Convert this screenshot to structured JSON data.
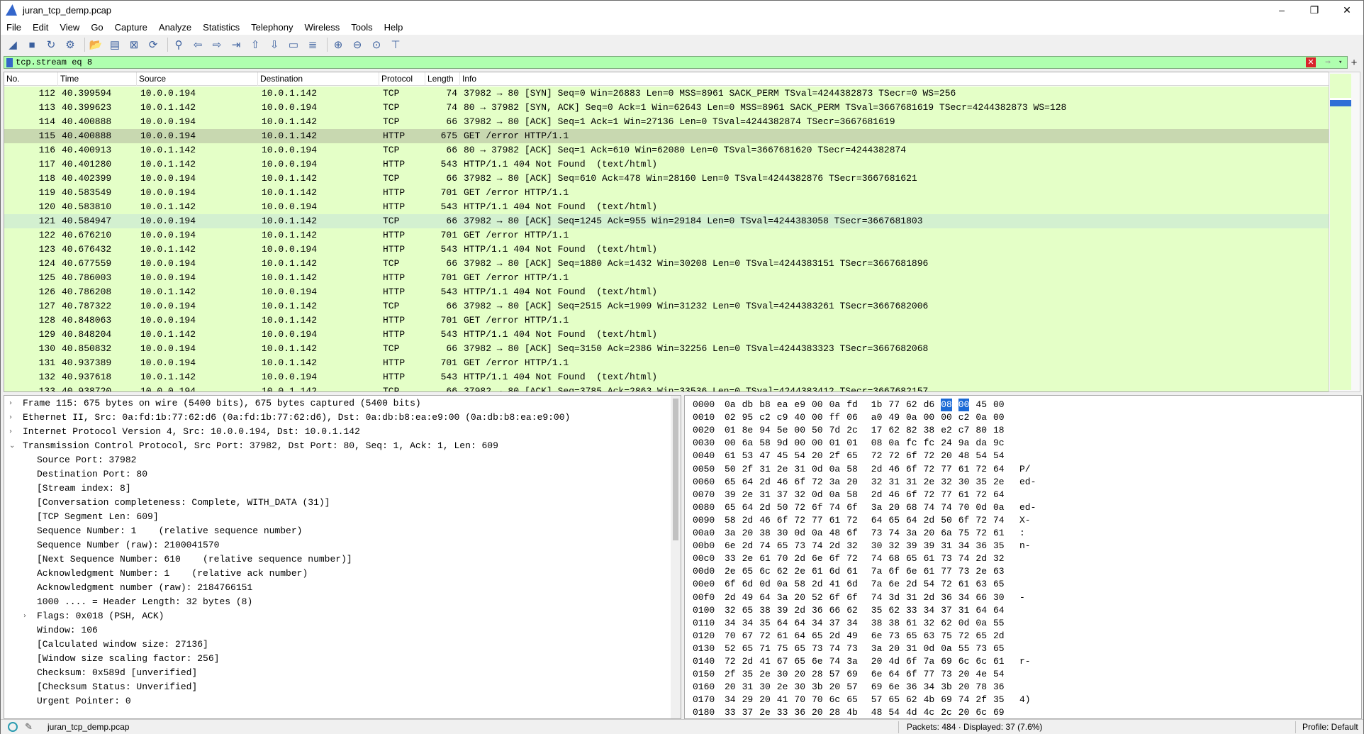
{
  "window": {
    "title": "juran_tcp_demp.pcap",
    "min": "–",
    "max": "❐",
    "close": "✕"
  },
  "menu": [
    "File",
    "Edit",
    "View",
    "Go",
    "Capture",
    "Analyze",
    "Statistics",
    "Telephony",
    "Wireless",
    "Tools",
    "Help"
  ],
  "toolbar_icons": [
    "shark-fin-start-icon",
    "stop-icon",
    "restart-icon",
    "options-icon",
    "open-icon",
    "file-icon",
    "close-file-icon",
    "reload-icon",
    "find-icon",
    "back-icon",
    "forward-icon",
    "goto-icon",
    "first-icon",
    "last-icon",
    "autoscroll-icon",
    "colorize-icon",
    "zoom-in-icon",
    "zoom-out-icon",
    "zoom-normal-icon",
    "resize-columns-icon"
  ],
  "filter": {
    "value": "tcp.stream eq 8",
    "clear": "✕",
    "apply": "⇒",
    "dropdown": "▾",
    "add": "+"
  },
  "packet_list": {
    "columns": [
      "No.",
      "Time",
      "Source",
      "Destination",
      "Protocol",
      "Length",
      "Info"
    ],
    "rows": [
      {
        "no": "112",
        "time": "40.399594",
        "src": "10.0.0.194",
        "dst": "10.0.1.142",
        "proto": "TCP",
        "len": "74",
        "info": "37982 → 80 [SYN] Seq=0 Win=26883 Len=0 MSS=8961 SACK_PERM TSval=4244382873 TSecr=0 WS=256"
      },
      {
        "no": "113",
        "time": "40.399623",
        "src": "10.0.1.142",
        "dst": "10.0.0.194",
        "proto": "TCP",
        "len": "74",
        "info": "80 → 37982 [SYN, ACK] Seq=0 Ack=1 Win=62643 Len=0 MSS=8961 SACK_PERM TSval=3667681619 TSecr=4244382873 WS=128"
      },
      {
        "no": "114",
        "time": "40.400888",
        "src": "10.0.0.194",
        "dst": "10.0.1.142",
        "proto": "TCP",
        "len": "66",
        "info": "37982 → 80 [ACK] Seq=1 Ack=1 Win=27136 Len=0 TSval=4244382874 TSecr=3667681619"
      },
      {
        "no": "115",
        "time": "40.400888",
        "src": "10.0.0.194",
        "dst": "10.0.1.142",
        "proto": "HTTP",
        "len": "675",
        "info": "GET /error HTTP/1.1"
      },
      {
        "no": "116",
        "time": "40.400913",
        "src": "10.0.1.142",
        "dst": "10.0.0.194",
        "proto": "TCP",
        "len": "66",
        "info": "80 → 37982 [ACK] Seq=1 Ack=610 Win=62080 Len=0 TSval=3667681620 TSecr=4244382874"
      },
      {
        "no": "117",
        "time": "40.401280",
        "src": "10.0.1.142",
        "dst": "10.0.0.194",
        "proto": "HTTP",
        "len": "543",
        "info": "HTTP/1.1 404 Not Found  (text/html)"
      },
      {
        "no": "118",
        "time": "40.402399",
        "src": "10.0.0.194",
        "dst": "10.0.1.142",
        "proto": "TCP",
        "len": "66",
        "info": "37982 → 80 [ACK] Seq=610 Ack=478 Win=28160 Len=0 TSval=4244382876 TSecr=3667681621"
      },
      {
        "no": "119",
        "time": "40.583549",
        "src": "10.0.0.194",
        "dst": "10.0.1.142",
        "proto": "HTTP",
        "len": "701",
        "info": "GET /error HTTP/1.1"
      },
      {
        "no": "120",
        "time": "40.583810",
        "src": "10.0.1.142",
        "dst": "10.0.0.194",
        "proto": "HTTP",
        "len": "543",
        "info": "HTTP/1.1 404 Not Found  (text/html)"
      },
      {
        "no": "121",
        "time": "40.584947",
        "src": "10.0.0.194",
        "dst": "10.0.1.142",
        "proto": "TCP",
        "len": "66",
        "info": "37982 → 80 [ACK] Seq=1245 Ack=955 Win=29184 Len=0 TSval=4244383058 TSecr=3667681803"
      },
      {
        "no": "122",
        "time": "40.676210",
        "src": "10.0.0.194",
        "dst": "10.0.1.142",
        "proto": "HTTP",
        "len": "701",
        "info": "GET /error HTTP/1.1"
      },
      {
        "no": "123",
        "time": "40.676432",
        "src": "10.0.1.142",
        "dst": "10.0.0.194",
        "proto": "HTTP",
        "len": "543",
        "info": "HTTP/1.1 404 Not Found  (text/html)"
      },
      {
        "no": "124",
        "time": "40.677559",
        "src": "10.0.0.194",
        "dst": "10.0.1.142",
        "proto": "TCP",
        "len": "66",
        "info": "37982 → 80 [ACK] Seq=1880 Ack=1432 Win=30208 Len=0 TSval=4244383151 TSecr=3667681896"
      },
      {
        "no": "125",
        "time": "40.786003",
        "src": "10.0.0.194",
        "dst": "10.0.1.142",
        "proto": "HTTP",
        "len": "701",
        "info": "GET /error HTTP/1.1"
      },
      {
        "no": "126",
        "time": "40.786208",
        "src": "10.0.1.142",
        "dst": "10.0.0.194",
        "proto": "HTTP",
        "len": "543",
        "info": "HTTP/1.1 404 Not Found  (text/html)"
      },
      {
        "no": "127",
        "time": "40.787322",
        "src": "10.0.0.194",
        "dst": "10.0.1.142",
        "proto": "TCP",
        "len": "66",
        "info": "37982 → 80 [ACK] Seq=2515 Ack=1909 Win=31232 Len=0 TSval=4244383261 TSecr=3667682006"
      },
      {
        "no": "128",
        "time": "40.848063",
        "src": "10.0.0.194",
        "dst": "10.0.1.142",
        "proto": "HTTP",
        "len": "701",
        "info": "GET /error HTTP/1.1"
      },
      {
        "no": "129",
        "time": "40.848204",
        "src": "10.0.1.142",
        "dst": "10.0.0.194",
        "proto": "HTTP",
        "len": "543",
        "info": "HTTP/1.1 404 Not Found  (text/html)"
      },
      {
        "no": "130",
        "time": "40.850832",
        "src": "10.0.0.194",
        "dst": "10.0.1.142",
        "proto": "TCP",
        "len": "66",
        "info": "37982 → 80 [ACK] Seq=3150 Ack=2386 Win=32256 Len=0 TSval=4244383323 TSecr=3667682068"
      },
      {
        "no": "131",
        "time": "40.937389",
        "src": "10.0.0.194",
        "dst": "10.0.1.142",
        "proto": "HTTP",
        "len": "701",
        "info": "GET /error HTTP/1.1"
      },
      {
        "no": "132",
        "time": "40.937618",
        "src": "10.0.1.142",
        "dst": "10.0.0.194",
        "proto": "HTTP",
        "len": "543",
        "info": "HTTP/1.1 404 Not Found  (text/html)"
      },
      {
        "no": "133",
        "time": "40.938720",
        "src": "10.0.0.194",
        "dst": "10.0.1.142",
        "proto": "TCP",
        "len": "66",
        "info": "37982 → 80 [ACK] Seq=3785 Ack=2863 Win=33536 Len=0 TSval=4244383412 TSecr=3667682157"
      }
    ]
  },
  "details": [
    {
      "indent": 0,
      "exp": "›",
      "text": "Frame 115: 675 bytes on wire (5400 bits), 675 bytes captured (5400 bits)"
    },
    {
      "indent": 0,
      "exp": "›",
      "text": "Ethernet II, Src: 0a:fd:1b:77:62:d6 (0a:fd:1b:77:62:d6), Dst: 0a:db:b8:ea:e9:00 (0a:db:b8:ea:e9:00)"
    },
    {
      "indent": 0,
      "exp": "›",
      "text": "Internet Protocol Version 4, Src: 10.0.0.194, Dst: 10.0.1.142"
    },
    {
      "indent": 0,
      "exp": "⌄",
      "text": "Transmission Control Protocol, Src Port: 37982, Dst Port: 80, Seq: 1, Ack: 1, Len: 609"
    },
    {
      "indent": 1,
      "exp": "",
      "text": "Source Port: 37982"
    },
    {
      "indent": 1,
      "exp": "",
      "text": "Destination Port: 80"
    },
    {
      "indent": 1,
      "exp": "",
      "text": "[Stream index: 8]"
    },
    {
      "indent": 1,
      "exp": "",
      "text": "[Conversation completeness: Complete, WITH_DATA (31)]"
    },
    {
      "indent": 1,
      "exp": "",
      "text": "[TCP Segment Len: 609]"
    },
    {
      "indent": 1,
      "exp": "",
      "text": "Sequence Number: 1    (relative sequence number)"
    },
    {
      "indent": 1,
      "exp": "",
      "text": "Sequence Number (raw): 2100041570"
    },
    {
      "indent": 1,
      "exp": "",
      "text": "[Next Sequence Number: 610    (relative sequence number)]"
    },
    {
      "indent": 1,
      "exp": "",
      "text": "Acknowledgment Number: 1    (relative ack number)"
    },
    {
      "indent": 1,
      "exp": "",
      "text": "Acknowledgment number (raw): 2184766151"
    },
    {
      "indent": 1,
      "exp": "",
      "text": "1000 .... = Header Length: 32 bytes (8)"
    },
    {
      "indent": 1,
      "exp": "›",
      "text": "Flags: 0x018 (PSH, ACK)"
    },
    {
      "indent": 1,
      "exp": "",
      "text": "Window: 106"
    },
    {
      "indent": 1,
      "exp": "",
      "text": "[Calculated window size: 27136]"
    },
    {
      "indent": 1,
      "exp": "",
      "text": "[Window size scaling factor: 256]"
    },
    {
      "indent": 1,
      "exp": "",
      "text": "Checksum: 0x589d [unverified]"
    },
    {
      "indent": 1,
      "exp": "",
      "text": "[Checksum Status: Unverified]"
    },
    {
      "indent": 1,
      "exp": "",
      "text": "Urgent Pointer: 0"
    }
  ],
  "hex": [
    {
      "off": "0000",
      "bytes": [
        "0a",
        "db",
        "b8",
        "ea",
        "e9",
        "00",
        "0a",
        "fd",
        "1b",
        "77",
        "62",
        "d6",
        "08",
        "00",
        "45",
        "00"
      ],
      "ascii": ""
    },
    {
      "off": "0010",
      "bytes": [
        "02",
        "95",
        "c2",
        "c9",
        "40",
        "00",
        "ff",
        "06",
        "a0",
        "49",
        "0a",
        "00",
        "00",
        "c2",
        "0a",
        "00"
      ],
      "ascii": ""
    },
    {
      "off": "0020",
      "bytes": [
        "01",
        "8e",
        "94",
        "5e",
        "00",
        "50",
        "7d",
        "2c",
        "17",
        "62",
        "82",
        "38",
        "e2",
        "c7",
        "80",
        "18"
      ],
      "ascii": ""
    },
    {
      "off": "0030",
      "bytes": [
        "00",
        "6a",
        "58",
        "9d",
        "00",
        "00",
        "01",
        "01",
        "08",
        "0a",
        "fc",
        "fc",
        "24",
        "9a",
        "da",
        "9c"
      ],
      "ascii": ""
    },
    {
      "off": "0040",
      "bytes": [
        "61",
        "53",
        "47",
        "45",
        "54",
        "20",
        "2f",
        "65",
        "72",
        "72",
        "6f",
        "72",
        "20",
        "48",
        "54",
        "54"
      ],
      "ascii": ""
    },
    {
      "off": "0050",
      "bytes": [
        "50",
        "2f",
        "31",
        "2e",
        "31",
        "0d",
        "0a",
        "58",
        "2d",
        "46",
        "6f",
        "72",
        "77",
        "61",
        "72",
        "64"
      ],
      "ascii": "P/"
    },
    {
      "off": "0060",
      "bytes": [
        "65",
        "64",
        "2d",
        "46",
        "6f",
        "72",
        "3a",
        "20",
        "32",
        "31",
        "31",
        "2e",
        "32",
        "30",
        "35",
        "2e"
      ],
      "ascii": "ed-"
    },
    {
      "off": "0070",
      "bytes": [
        "39",
        "2e",
        "31",
        "37",
        "32",
        "0d",
        "0a",
        "58",
        "2d",
        "46",
        "6f",
        "72",
        "77",
        "61",
        "72",
        "64"
      ],
      "ascii": ""
    },
    {
      "off": "0080",
      "bytes": [
        "65",
        "64",
        "2d",
        "50",
        "72",
        "6f",
        "74",
        "6f",
        "3a",
        "20",
        "68",
        "74",
        "74",
        "70",
        "0d",
        "0a"
      ],
      "ascii": "ed-"
    },
    {
      "off": "0090",
      "bytes": [
        "58",
        "2d",
        "46",
        "6f",
        "72",
        "77",
        "61",
        "72",
        "64",
        "65",
        "64",
        "2d",
        "50",
        "6f",
        "72",
        "74"
      ],
      "ascii": "X-"
    },
    {
      "off": "00a0",
      "bytes": [
        "3a",
        "20",
        "38",
        "30",
        "0d",
        "0a",
        "48",
        "6f",
        "73",
        "74",
        "3a",
        "20",
        "6a",
        "75",
        "72",
        "61"
      ],
      "ascii": ":"
    },
    {
      "off": "00b0",
      "bytes": [
        "6e",
        "2d",
        "74",
        "65",
        "73",
        "74",
        "2d",
        "32",
        "30",
        "32",
        "39",
        "39",
        "31",
        "34",
        "36",
        "35"
      ],
      "ascii": "n-"
    },
    {
      "off": "00c0",
      "bytes": [
        "33",
        "2e",
        "61",
        "70",
        "2d",
        "6e",
        "6f",
        "72",
        "74",
        "68",
        "65",
        "61",
        "73",
        "74",
        "2d",
        "32"
      ],
      "ascii": ""
    },
    {
      "off": "00d0",
      "bytes": [
        "2e",
        "65",
        "6c",
        "62",
        "2e",
        "61",
        "6d",
        "61",
        "7a",
        "6f",
        "6e",
        "61",
        "77",
        "73",
        "2e",
        "63"
      ],
      "ascii": ""
    },
    {
      "off": "00e0",
      "bytes": [
        "6f",
        "6d",
        "0d",
        "0a",
        "58",
        "2d",
        "41",
        "6d",
        "7a",
        "6e",
        "2d",
        "54",
        "72",
        "61",
        "63",
        "65"
      ],
      "ascii": ""
    },
    {
      "off": "00f0",
      "bytes": [
        "2d",
        "49",
        "64",
        "3a",
        "20",
        "52",
        "6f",
        "6f",
        "74",
        "3d",
        "31",
        "2d",
        "36",
        "34",
        "66",
        "30"
      ],
      "ascii": "-"
    },
    {
      "off": "0100",
      "bytes": [
        "32",
        "65",
        "38",
        "39",
        "2d",
        "36",
        "66",
        "62",
        "35",
        "62",
        "33",
        "34",
        "37",
        "31",
        "64",
        "64"
      ],
      "ascii": ""
    },
    {
      "off": "0110",
      "bytes": [
        "34",
        "34",
        "35",
        "64",
        "64",
        "34",
        "37",
        "34",
        "38",
        "38",
        "61",
        "32",
        "62",
        "0d",
        "0a",
        "55"
      ],
      "ascii": ""
    },
    {
      "off": "0120",
      "bytes": [
        "70",
        "67",
        "72",
        "61",
        "64",
        "65",
        "2d",
        "49",
        "6e",
        "73",
        "65",
        "63",
        "75",
        "72",
        "65",
        "2d"
      ],
      "ascii": ""
    },
    {
      "off": "0130",
      "bytes": [
        "52",
        "65",
        "71",
        "75",
        "65",
        "73",
        "74",
        "73",
        "3a",
        "20",
        "31",
        "0d",
        "0a",
        "55",
        "73",
        "65"
      ],
      "ascii": ""
    },
    {
      "off": "0140",
      "bytes": [
        "72",
        "2d",
        "41",
        "67",
        "65",
        "6e",
        "74",
        "3a",
        "20",
        "4d",
        "6f",
        "7a",
        "69",
        "6c",
        "6c",
        "61"
      ],
      "ascii": "r-"
    },
    {
      "off": "0150",
      "bytes": [
        "2f",
        "35",
        "2e",
        "30",
        "20",
        "28",
        "57",
        "69",
        "6e",
        "64",
        "6f",
        "77",
        "73",
        "20",
        "4e",
        "54"
      ],
      "ascii": ""
    },
    {
      "off": "0160",
      "bytes": [
        "20",
        "31",
        "30",
        "2e",
        "30",
        "3b",
        "20",
        "57",
        "69",
        "6e",
        "36",
        "34",
        "3b",
        "20",
        "78",
        "36"
      ],
      "ascii": ""
    },
    {
      "off": "0170",
      "bytes": [
        "34",
        "29",
        "20",
        "41",
        "70",
        "70",
        "6c",
        "65",
        "57",
        "65",
        "62",
        "4b",
        "69",
        "74",
        "2f",
        "35"
      ],
      "ascii": "4)"
    },
    {
      "off": "0180",
      "bytes": [
        "33",
        "37",
        "2e",
        "33",
        "36",
        "20",
        "28",
        "4b",
        "48",
        "54",
        "4d",
        "4c",
        "2c",
        "20",
        "6c",
        "69"
      ],
      "ascii": ""
    }
  ],
  "status": {
    "file": "juran_tcp_demp.pcap",
    "packets": "Packets: 484 · Displayed: 37 (7.6%)",
    "profile": "Profile: Default"
  }
}
